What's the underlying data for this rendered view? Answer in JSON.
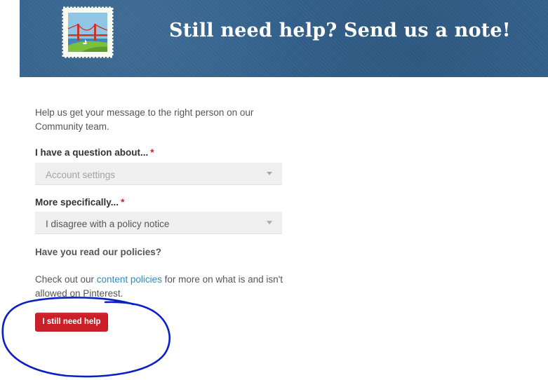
{
  "banner": {
    "title": "Still need help? Send us a note!",
    "background_color": "#33628e",
    "stamp_icon": "golden-gate-bridge-stamp-icon"
  },
  "form": {
    "intro": "Help us get your message to the right person on our Community team.",
    "question_field": {
      "label": "I have a question about...",
      "required_mark": "*",
      "value": "Account settings"
    },
    "specific_field": {
      "label": "More specifically...",
      "required_mark": "*",
      "value": "I disagree with a policy notice"
    },
    "policies": {
      "heading": "Have you read our policies?",
      "text_before": "Check out our ",
      "link_label": "content policies",
      "text_after": " for more on what is and isn't allowed on Pinterest."
    },
    "submit_label": "I still need help"
  },
  "colors": {
    "accent_red": "#cb2027",
    "link_blue": "#2a8dc4",
    "annotation_blue": "#0a1fc8"
  }
}
